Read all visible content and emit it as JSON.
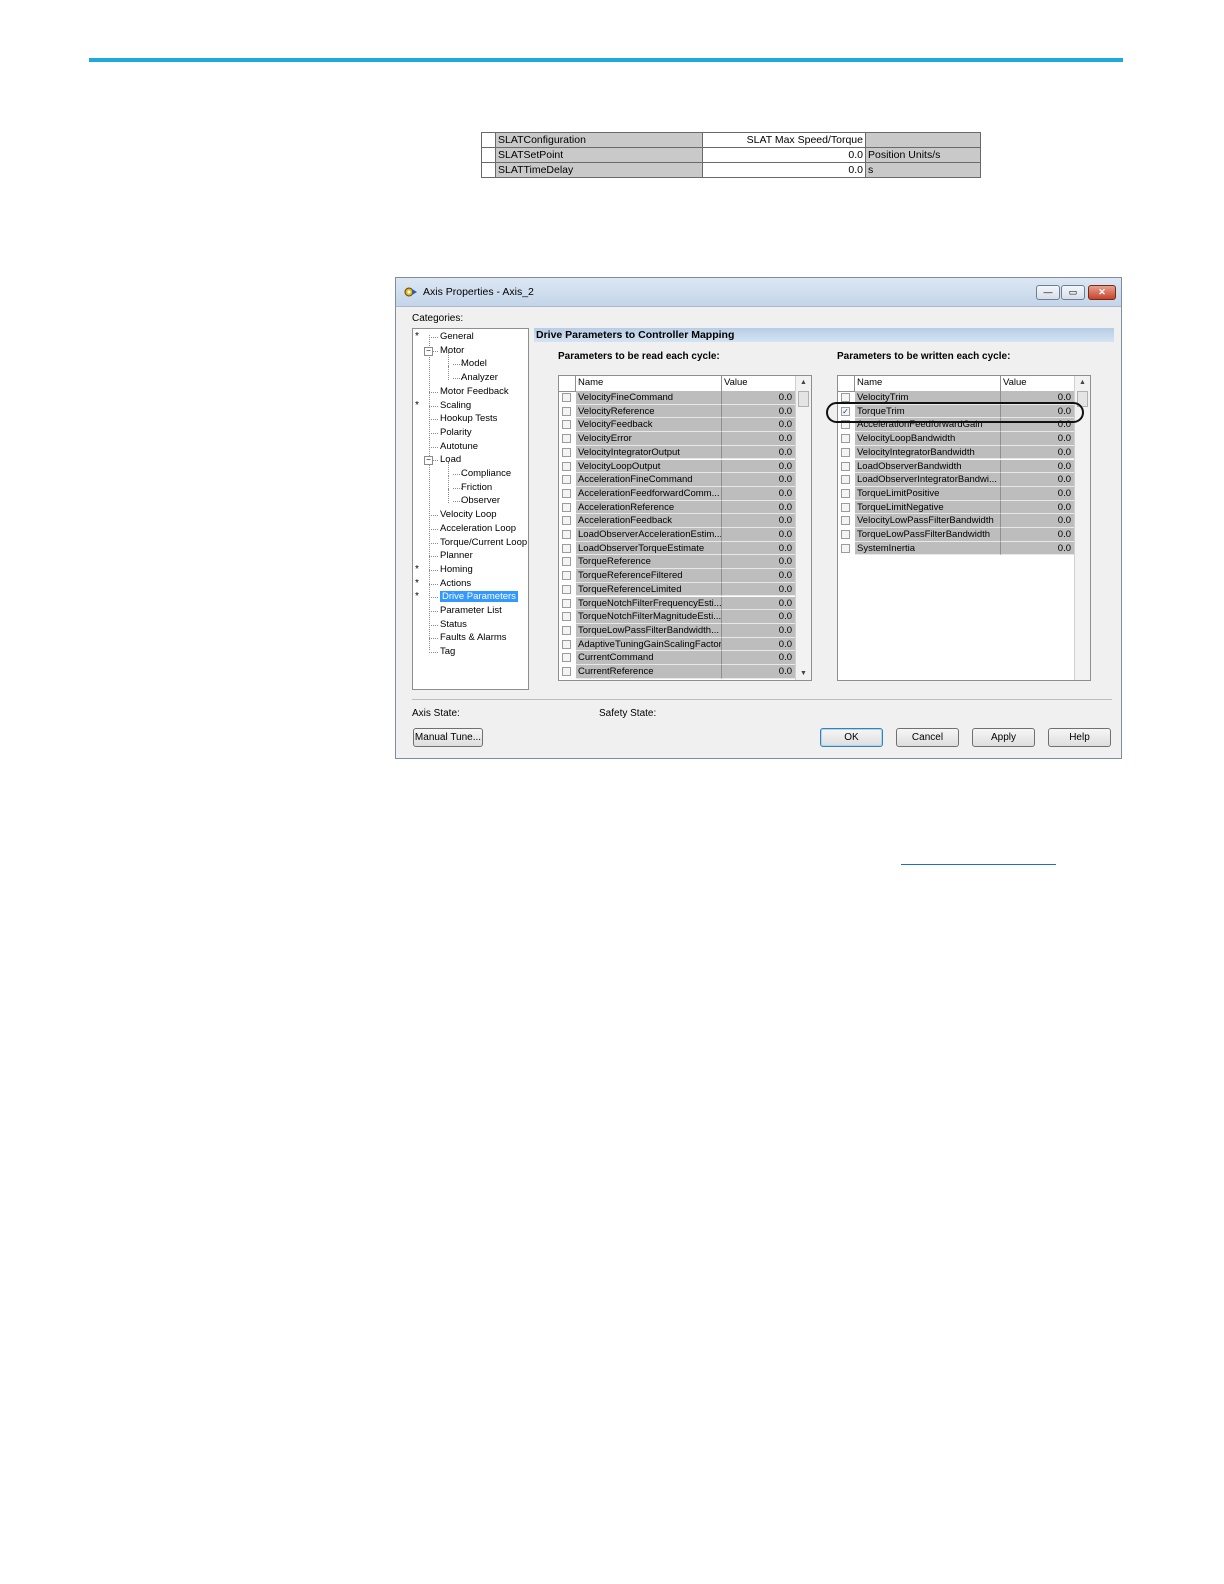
{
  "slat_table": [
    {
      "name": "SLATConfiguration",
      "value": "SLAT Max Speed/Torque",
      "unit": ""
    },
    {
      "name": "SLATSetPoint",
      "value": "0.0",
      "unit": "Position Units/s"
    },
    {
      "name": "SLATTimeDelay",
      "value": "0.0",
      "unit": "s"
    }
  ],
  "window": {
    "title": "Axis Properties - Axis_2",
    "categories_label": "Categories:",
    "panel_header": "Drive Parameters to Controller Mapping",
    "read_heading": "Parameters to be read each cycle:",
    "write_heading": "Parameters to be written each cycle:",
    "col_name": "Name",
    "col_value": "Value",
    "axis_state_label": "Axis State:",
    "safety_state_label": "Safety State:",
    "buttons": {
      "manual_tune": "Manual Tune...",
      "ok": "OK",
      "cancel": "Cancel",
      "apply": "Apply",
      "help": "Help"
    },
    "window_buttons": {
      "min": "—",
      "max": "▭",
      "close": "✕"
    }
  },
  "tree": [
    {
      "label": "General",
      "level": 0,
      "star": true,
      "expand": ""
    },
    {
      "label": "Motor",
      "level": 0,
      "star": false,
      "expand": "−"
    },
    {
      "label": "Model",
      "level": 1,
      "star": false,
      "expand": ""
    },
    {
      "label": "Analyzer",
      "level": 1,
      "star": false,
      "expand": ""
    },
    {
      "label": "Motor Feedback",
      "level": 0,
      "star": false,
      "expand": ""
    },
    {
      "label": "Scaling",
      "level": 0,
      "star": true,
      "expand": ""
    },
    {
      "label": "Hookup Tests",
      "level": 0,
      "star": false,
      "expand": ""
    },
    {
      "label": "Polarity",
      "level": 0,
      "star": false,
      "expand": ""
    },
    {
      "label": "Autotune",
      "level": 0,
      "star": false,
      "expand": ""
    },
    {
      "label": "Load",
      "level": 0,
      "star": false,
      "expand": "−"
    },
    {
      "label": "Compliance",
      "level": 1,
      "star": false,
      "expand": ""
    },
    {
      "label": "Friction",
      "level": 1,
      "star": false,
      "expand": ""
    },
    {
      "label": "Observer",
      "level": 1,
      "star": false,
      "expand": ""
    },
    {
      "label": "Velocity Loop",
      "level": 0,
      "star": false,
      "expand": ""
    },
    {
      "label": "Acceleration Loop",
      "level": 0,
      "star": false,
      "expand": ""
    },
    {
      "label": "Torque/Current Loop",
      "level": 0,
      "star": false,
      "expand": ""
    },
    {
      "label": "Planner",
      "level": 0,
      "star": false,
      "expand": ""
    },
    {
      "label": "Homing",
      "level": 0,
      "star": true,
      "expand": ""
    },
    {
      "label": "Actions",
      "level": 0,
      "star": true,
      "expand": ""
    },
    {
      "label": "Drive Parameters",
      "level": 0,
      "star": true,
      "expand": "",
      "selected": true
    },
    {
      "label": "Parameter List",
      "level": 0,
      "star": false,
      "expand": ""
    },
    {
      "label": "Status",
      "level": 0,
      "star": false,
      "expand": ""
    },
    {
      "label": "Faults & Alarms",
      "level": 0,
      "star": false,
      "expand": ""
    },
    {
      "label": "Tag",
      "level": 0,
      "star": false,
      "expand": ""
    }
  ],
  "read_params": [
    {
      "name": "VelocityFineCommand",
      "value": "0.0",
      "checked": false
    },
    {
      "name": "VelocityReference",
      "value": "0.0",
      "checked": false
    },
    {
      "name": "VelocityFeedback",
      "value": "0.0",
      "checked": false
    },
    {
      "name": "VelocityError",
      "value": "0.0",
      "checked": false
    },
    {
      "name": "VelocityIntegratorOutput",
      "value": "0.0",
      "checked": false
    },
    {
      "name": "VelocityLoopOutput",
      "value": "0.0",
      "checked": false
    },
    {
      "name": "AccelerationFineCommand",
      "value": "0.0",
      "checked": false
    },
    {
      "name": "AccelerationFeedforwardComm...",
      "value": "0.0",
      "checked": false
    },
    {
      "name": "AccelerationReference",
      "value": "0.0",
      "checked": false
    },
    {
      "name": "AccelerationFeedback",
      "value": "0.0",
      "checked": false
    },
    {
      "name": "LoadObserverAccelerationEstim...",
      "value": "0.0",
      "checked": false
    },
    {
      "name": "LoadObserverTorqueEstimate",
      "value": "0.0",
      "checked": false
    },
    {
      "name": "TorqueReference",
      "value": "0.0",
      "checked": false
    },
    {
      "name": "TorqueReferenceFiltered",
      "value": "0.0",
      "checked": false
    },
    {
      "name": "TorqueReferenceLimited",
      "value": "0.0",
      "checked": false
    },
    {
      "name": "TorqueNotchFilterFrequencyEsti...",
      "value": "0.0",
      "checked": false
    },
    {
      "name": "TorqueNotchFilterMagnitudeEsti...",
      "value": "0.0",
      "checked": false
    },
    {
      "name": "TorqueLowPassFilterBandwidth...",
      "value": "0.0",
      "checked": false
    },
    {
      "name": "AdaptiveTuningGainScalingFactor",
      "value": "0.0",
      "checked": false
    },
    {
      "name": "CurrentCommand",
      "value": "0.0",
      "checked": false
    },
    {
      "name": "CurrentReference",
      "value": "0.0",
      "checked": false
    }
  ],
  "write_params": [
    {
      "name": "VelocityTrim",
      "value": "0.0",
      "checked": false
    },
    {
      "name": "TorqueTrim",
      "value": "0.0",
      "checked": true
    },
    {
      "name": "AccelerationFeedforwardGain",
      "value": "0.0",
      "checked": false
    },
    {
      "name": "VelocityLoopBandwidth",
      "value": "0.0",
      "checked": false
    },
    {
      "name": "VelocityIntegratorBandwidth",
      "value": "0.0",
      "checked": false
    },
    {
      "name": "LoadObserverBandwidth",
      "value": "0.0",
      "checked": false
    },
    {
      "name": "LoadObserverIntegratorBandwi...",
      "value": "0.0",
      "checked": false
    },
    {
      "name": "TorqueLimitPositive",
      "value": "0.0",
      "checked": false
    },
    {
      "name": "TorqueLimitNegative",
      "value": "0.0",
      "checked": false
    },
    {
      "name": "VelocityLowPassFilterBandwidth",
      "value": "0.0",
      "checked": false
    },
    {
      "name": "TorqueLowPassFilterBandwidth",
      "value": "0.0",
      "checked": false
    },
    {
      "name": "SystemInertia",
      "value": "0.0",
      "checked": false
    }
  ],
  "colors": {
    "accent_rule": "#1fa8e0",
    "selection": "#3399ff",
    "row_fill": "#bdbdbd"
  },
  "icons": {
    "app": "axis-properties-icon",
    "check": "✓",
    "scroll_up": "▲",
    "scroll_down": "▼"
  }
}
